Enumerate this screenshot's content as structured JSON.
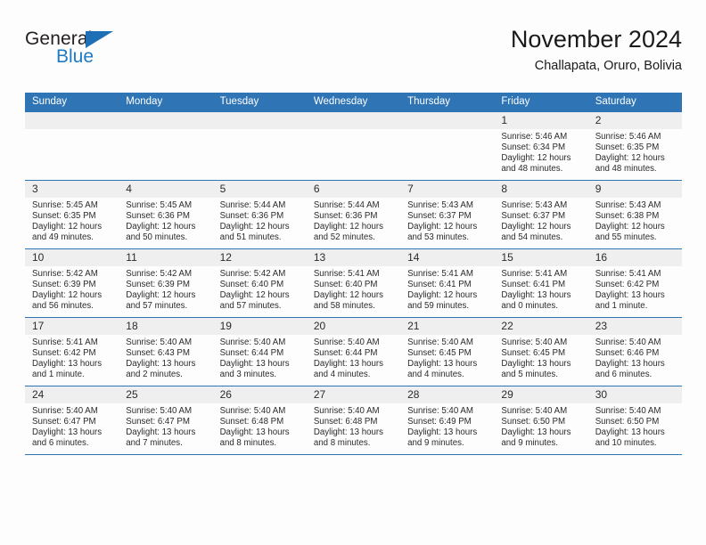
{
  "brand": {
    "name_part1": "General",
    "name_part2": "Blue",
    "triangle_icon": "triangle-logo-icon",
    "accent_color": "#1e6fb5"
  },
  "header": {
    "month_title": "November 2024",
    "location": "Challapata, Oruro, Bolivia"
  },
  "theme": {
    "header_blue": "#2f74b5",
    "daynum_gray": "#efefef",
    "text_color": "#2b2b2b",
    "page_background": "#fdfdfd"
  },
  "calendar": {
    "weekday_headers": [
      "Sunday",
      "Monday",
      "Tuesday",
      "Wednesday",
      "Thursday",
      "Friday",
      "Saturday"
    ],
    "weeks": [
      [
        {
          "day": "",
          "empty": true
        },
        {
          "day": "",
          "empty": true
        },
        {
          "day": "",
          "empty": true
        },
        {
          "day": "",
          "empty": true
        },
        {
          "day": "",
          "empty": true
        },
        {
          "day": "1",
          "sunrise": "Sunrise: 5:46 AM",
          "sunset": "Sunset: 6:34 PM",
          "daylight_line1": "Daylight: 12 hours",
          "daylight_line2": "and 48 minutes."
        },
        {
          "day": "2",
          "sunrise": "Sunrise: 5:46 AM",
          "sunset": "Sunset: 6:35 PM",
          "daylight_line1": "Daylight: 12 hours",
          "daylight_line2": "and 48 minutes."
        }
      ],
      [
        {
          "day": "3",
          "sunrise": "Sunrise: 5:45 AM",
          "sunset": "Sunset: 6:35 PM",
          "daylight_line1": "Daylight: 12 hours",
          "daylight_line2": "and 49 minutes."
        },
        {
          "day": "4",
          "sunrise": "Sunrise: 5:45 AM",
          "sunset": "Sunset: 6:36 PM",
          "daylight_line1": "Daylight: 12 hours",
          "daylight_line2": "and 50 minutes."
        },
        {
          "day": "5",
          "sunrise": "Sunrise: 5:44 AM",
          "sunset": "Sunset: 6:36 PM",
          "daylight_line1": "Daylight: 12 hours",
          "daylight_line2": "and 51 minutes."
        },
        {
          "day": "6",
          "sunrise": "Sunrise: 5:44 AM",
          "sunset": "Sunset: 6:36 PM",
          "daylight_line1": "Daylight: 12 hours",
          "daylight_line2": "and 52 minutes."
        },
        {
          "day": "7",
          "sunrise": "Sunrise: 5:43 AM",
          "sunset": "Sunset: 6:37 PM",
          "daylight_line1": "Daylight: 12 hours",
          "daylight_line2": "and 53 minutes."
        },
        {
          "day": "8",
          "sunrise": "Sunrise: 5:43 AM",
          "sunset": "Sunset: 6:37 PM",
          "daylight_line1": "Daylight: 12 hours",
          "daylight_line2": "and 54 minutes."
        },
        {
          "day": "9",
          "sunrise": "Sunrise: 5:43 AM",
          "sunset": "Sunset: 6:38 PM",
          "daylight_line1": "Daylight: 12 hours",
          "daylight_line2": "and 55 minutes."
        }
      ],
      [
        {
          "day": "10",
          "sunrise": "Sunrise: 5:42 AM",
          "sunset": "Sunset: 6:39 PM",
          "daylight_line1": "Daylight: 12 hours",
          "daylight_line2": "and 56 minutes."
        },
        {
          "day": "11",
          "sunrise": "Sunrise: 5:42 AM",
          "sunset": "Sunset: 6:39 PM",
          "daylight_line1": "Daylight: 12 hours",
          "daylight_line2": "and 57 minutes."
        },
        {
          "day": "12",
          "sunrise": "Sunrise: 5:42 AM",
          "sunset": "Sunset: 6:40 PM",
          "daylight_line1": "Daylight: 12 hours",
          "daylight_line2": "and 57 minutes."
        },
        {
          "day": "13",
          "sunrise": "Sunrise: 5:41 AM",
          "sunset": "Sunset: 6:40 PM",
          "daylight_line1": "Daylight: 12 hours",
          "daylight_line2": "and 58 minutes."
        },
        {
          "day": "14",
          "sunrise": "Sunrise: 5:41 AM",
          "sunset": "Sunset: 6:41 PM",
          "daylight_line1": "Daylight: 12 hours",
          "daylight_line2": "and 59 minutes."
        },
        {
          "day": "15",
          "sunrise": "Sunrise: 5:41 AM",
          "sunset": "Sunset: 6:41 PM",
          "daylight_line1": "Daylight: 13 hours",
          "daylight_line2": "and 0 minutes."
        },
        {
          "day": "16",
          "sunrise": "Sunrise: 5:41 AM",
          "sunset": "Sunset: 6:42 PM",
          "daylight_line1": "Daylight: 13 hours",
          "daylight_line2": "and 1 minute."
        }
      ],
      [
        {
          "day": "17",
          "sunrise": "Sunrise: 5:41 AM",
          "sunset": "Sunset: 6:42 PM",
          "daylight_line1": "Daylight: 13 hours",
          "daylight_line2": "and 1 minute."
        },
        {
          "day": "18",
          "sunrise": "Sunrise: 5:40 AM",
          "sunset": "Sunset: 6:43 PM",
          "daylight_line1": "Daylight: 13 hours",
          "daylight_line2": "and 2 minutes."
        },
        {
          "day": "19",
          "sunrise": "Sunrise: 5:40 AM",
          "sunset": "Sunset: 6:44 PM",
          "daylight_line1": "Daylight: 13 hours",
          "daylight_line2": "and 3 minutes."
        },
        {
          "day": "20",
          "sunrise": "Sunrise: 5:40 AM",
          "sunset": "Sunset: 6:44 PM",
          "daylight_line1": "Daylight: 13 hours",
          "daylight_line2": "and 4 minutes."
        },
        {
          "day": "21",
          "sunrise": "Sunrise: 5:40 AM",
          "sunset": "Sunset: 6:45 PM",
          "daylight_line1": "Daylight: 13 hours",
          "daylight_line2": "and 4 minutes."
        },
        {
          "day": "22",
          "sunrise": "Sunrise: 5:40 AM",
          "sunset": "Sunset: 6:45 PM",
          "daylight_line1": "Daylight: 13 hours",
          "daylight_line2": "and 5 minutes."
        },
        {
          "day": "23",
          "sunrise": "Sunrise: 5:40 AM",
          "sunset": "Sunset: 6:46 PM",
          "daylight_line1": "Daylight: 13 hours",
          "daylight_line2": "and 6 minutes."
        }
      ],
      [
        {
          "day": "24",
          "sunrise": "Sunrise: 5:40 AM",
          "sunset": "Sunset: 6:47 PM",
          "daylight_line1": "Daylight: 13 hours",
          "daylight_line2": "and 6 minutes."
        },
        {
          "day": "25",
          "sunrise": "Sunrise: 5:40 AM",
          "sunset": "Sunset: 6:47 PM",
          "daylight_line1": "Daylight: 13 hours",
          "daylight_line2": "and 7 minutes."
        },
        {
          "day": "26",
          "sunrise": "Sunrise: 5:40 AM",
          "sunset": "Sunset: 6:48 PM",
          "daylight_line1": "Daylight: 13 hours",
          "daylight_line2": "and 8 minutes."
        },
        {
          "day": "27",
          "sunrise": "Sunrise: 5:40 AM",
          "sunset": "Sunset: 6:48 PM",
          "daylight_line1": "Daylight: 13 hours",
          "daylight_line2": "and 8 minutes."
        },
        {
          "day": "28",
          "sunrise": "Sunrise: 5:40 AM",
          "sunset": "Sunset: 6:49 PM",
          "daylight_line1": "Daylight: 13 hours",
          "daylight_line2": "and 9 minutes."
        },
        {
          "day": "29",
          "sunrise": "Sunrise: 5:40 AM",
          "sunset": "Sunset: 6:50 PM",
          "daylight_line1": "Daylight: 13 hours",
          "daylight_line2": "and 9 minutes."
        },
        {
          "day": "30",
          "sunrise": "Sunrise: 5:40 AM",
          "sunset": "Sunset: 6:50 PM",
          "daylight_line1": "Daylight: 13 hours",
          "daylight_line2": "and 10 minutes."
        }
      ]
    ]
  }
}
